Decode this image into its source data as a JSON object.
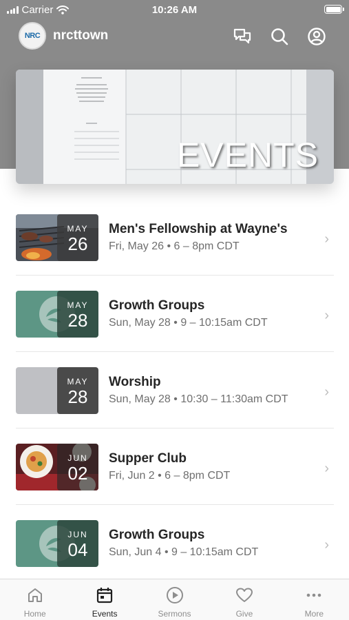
{
  "status_bar": {
    "carrier": "Carrier",
    "time": "10:26 AM"
  },
  "header": {
    "logo_text": "NRC",
    "brand": "nrcttown",
    "icons": [
      "chat-icon",
      "search-icon",
      "account-icon"
    ]
  },
  "hero": {
    "title": "EVENTS"
  },
  "events": [
    {
      "month": "MAY",
      "day": "26",
      "title": "Men's Fellowship at Wayne's",
      "subtitle": "Fri, May 26 • 6 – 8pm CDT",
      "thumb": "grill-photo"
    },
    {
      "month": "MAY",
      "day": "28",
      "title": "Growth Groups",
      "subtitle": "Sun, May 28 • 9 – 10:15am CDT",
      "thumb": "leaf-logo"
    },
    {
      "month": "MAY",
      "day": "28",
      "title": "Worship",
      "subtitle": "Sun, May 28 • 10:30 – 11:30am CDT",
      "thumb": "plain-gray"
    },
    {
      "month": "JUN",
      "day": "02",
      "title": "Supper Club",
      "subtitle": "Fri, Jun 2 • 6 – 8pm CDT",
      "thumb": "food-photo"
    },
    {
      "month": "JUN",
      "day": "04",
      "title": "Growth Groups",
      "subtitle": "Sun, Jun 4 • 9 – 10:15am CDT",
      "thumb": "leaf-logo"
    }
  ],
  "tabs": [
    {
      "label": "Home",
      "icon": "home-icon",
      "active": false
    },
    {
      "label": "Events",
      "icon": "calendar-icon",
      "active": true
    },
    {
      "label": "Sermons",
      "icon": "play-icon",
      "active": false
    },
    {
      "label": "Give",
      "icon": "heart-icon",
      "active": false
    },
    {
      "label": "More",
      "icon": "more-icon",
      "active": false
    }
  ],
  "colors": {
    "header_band": "#8a8a8a",
    "leaf_green": "#5d9685",
    "badge_dark": "#3a3a3a",
    "active_tab": "#1f1f1f",
    "inactive_tab": "#8e8e8e"
  }
}
